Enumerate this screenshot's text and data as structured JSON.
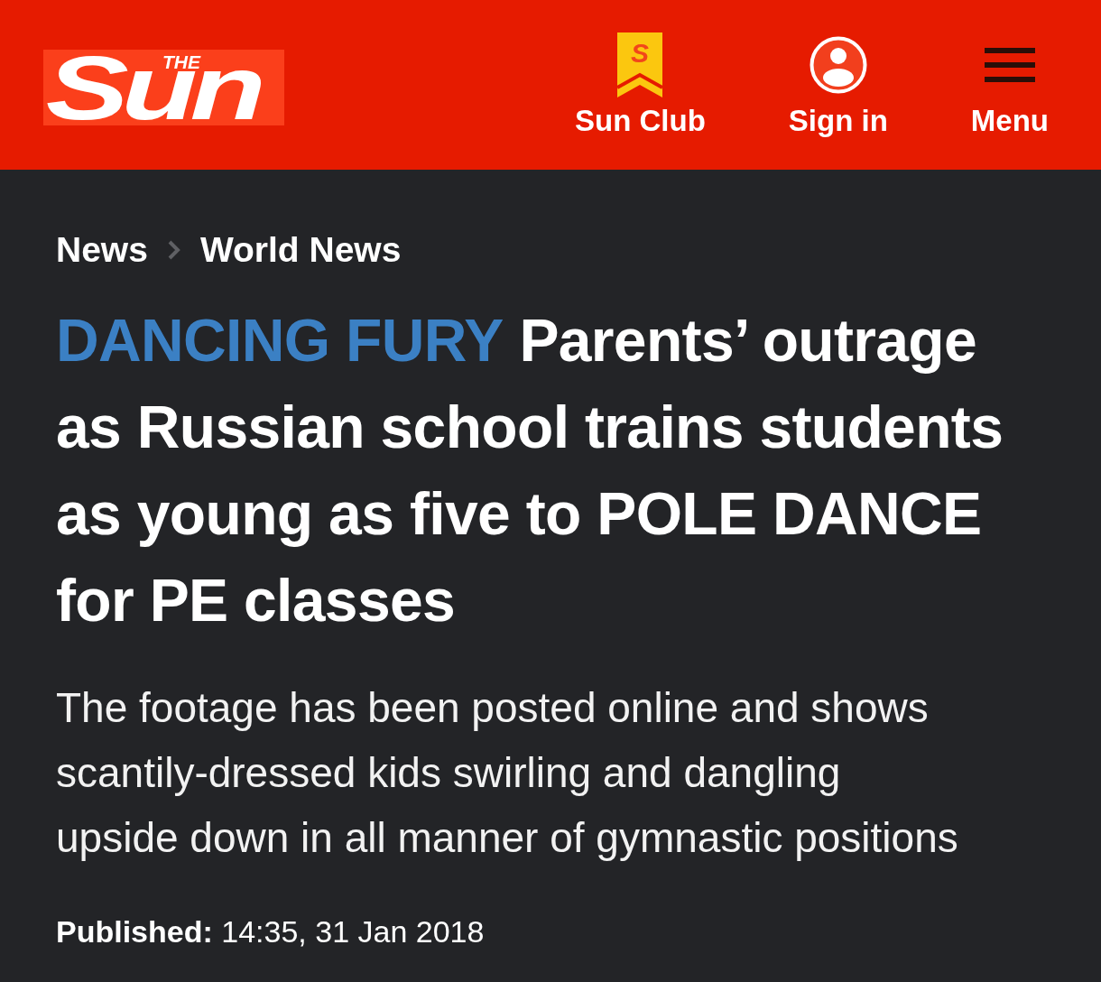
{
  "header": {
    "logo": {
      "small": "THE",
      "large": "Sun"
    },
    "nav": [
      {
        "kind": "club",
        "label": "Sun Club",
        "badge_letter": "S"
      },
      {
        "kind": "account",
        "label": "Sign in"
      },
      {
        "kind": "menu",
        "label": "Menu"
      }
    ]
  },
  "breadcrumb": [
    "News",
    "World News"
  ],
  "article": {
    "kicker": "DANCING FURY",
    "headline": "Parents’ outrage as Russian school trains students as young as five to POLE DANCE for PE classes",
    "standfirst": "The footage has been posted online and shows scantily-dressed kids swirling and dangling upside down in all manner of gymnastic positions",
    "published": "**Published:** 14:35, 31 Jan 2018"
  }
}
